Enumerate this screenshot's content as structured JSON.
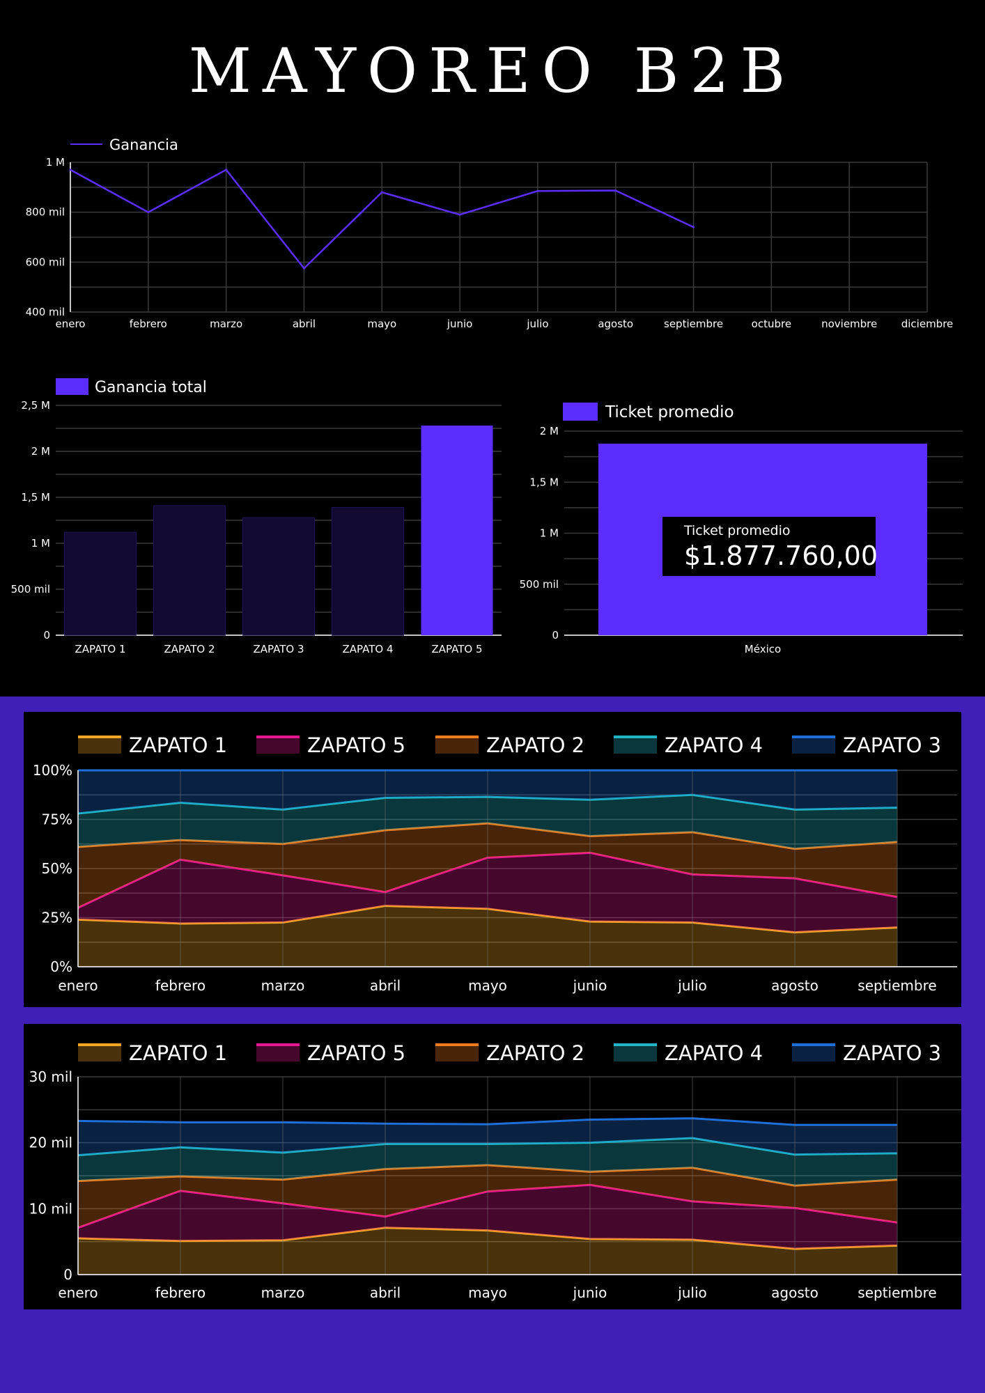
{
  "page": {
    "title": "MAYOREO B2B"
  },
  "colors": {
    "primary": "#5b2eff",
    "zapato1": "#f5a623",
    "zapato5": "#e6168e",
    "zapato2": "#f07c1c",
    "zapato4": "#1fb5c4",
    "zapato3": "#1e6fd9"
  },
  "chart_data": [
    {
      "type": "line",
      "title": "",
      "legend": "top-left",
      "series": [
        {
          "name": "Ganancia",
          "values": [
            970000,
            800000,
            970000,
            575000,
            880000,
            790000,
            885000,
            887000,
            740000,
            null,
            null,
            null
          ]
        }
      ],
      "categories": [
        "enero",
        "febrero",
        "marzo",
        "abril",
        "mayo",
        "junio",
        "julio",
        "agosto",
        "septiembre",
        "octubre",
        "noviembre",
        "diciembre"
      ],
      "ylim": [
        400000,
        1000000
      ],
      "yticks": [
        {
          "value": 400000,
          "label": "400 mil"
        },
        {
          "value": 600000,
          "label": "600 mil"
        },
        {
          "value": 800000,
          "label": "800 mil"
        },
        {
          "value": 1000000,
          "label": "1 M"
        }
      ],
      "grid": true
    },
    {
      "type": "bar",
      "legend": "top-left",
      "series": [
        {
          "name": "Ganancia total",
          "values": [
            1120000,
            1410000,
            1280000,
            1390000,
            2280000
          ]
        }
      ],
      "categories": [
        "ZAPATO 1",
        "ZAPATO 2",
        "ZAPATO 3",
        "ZAPATO 4",
        "ZAPATO 5"
      ],
      "highlight_index": 4,
      "ylim": [
        0,
        2500000
      ],
      "yticks": [
        {
          "value": 0,
          "label": "0"
        },
        {
          "value": 500000,
          "label": "500 mil"
        },
        {
          "value": 1000000,
          "label": "1 M"
        },
        {
          "value": 1500000,
          "label": "1,5 M"
        },
        {
          "value": 2000000,
          "label": "2 M"
        },
        {
          "value": 2500000,
          "label": "2,5 M"
        }
      ],
      "grid": true
    },
    {
      "type": "bar",
      "legend": "top-left",
      "series": [
        {
          "name": "Ticket promedio",
          "values": [
            1877760
          ]
        }
      ],
      "categories": [
        "México"
      ],
      "ylim": [
        0,
        2000000
      ],
      "yticks": [
        {
          "value": 0,
          "label": "0"
        },
        {
          "value": 500000,
          "label": "500 mil"
        },
        {
          "value": 1000000,
          "label": "1 M"
        },
        {
          "value": 1500000,
          "label": "1,5 M"
        },
        {
          "value": 2000000,
          "label": "2 M"
        }
      ],
      "tooltip": {
        "label": "Ticket promedio",
        "value": "$1.877.760,00"
      },
      "grid": true
    },
    {
      "type": "area",
      "stacked": "percent",
      "legend": "top",
      "categories": [
        "enero",
        "febrero",
        "marzo",
        "abril",
        "mayo",
        "junio",
        "julio",
        "agosto",
        "septiembre"
      ],
      "series": [
        {
          "name": "ZAPATO 1",
          "values": [
            24,
            22,
            22.5,
            31,
            29.5,
            23,
            22.5,
            17.5,
            20
          ]
        },
        {
          "name": "ZAPATO 5",
          "values": [
            6,
            32.5,
            24,
            7,
            26,
            35,
            24.5,
            27.5,
            15.5
          ]
        },
        {
          "name": "ZAPATO 2",
          "values": [
            31,
            10,
            16,
            31.5,
            17.5,
            8.5,
            21.5,
            15,
            28
          ]
        },
        {
          "name": "ZAPATO 4",
          "values": [
            17,
            19,
            17.5,
            16.5,
            13.5,
            18.5,
            19,
            20,
            17.5
          ]
        },
        {
          "name": "ZAPATO 3",
          "values": [
            22,
            16.5,
            20,
            14,
            13.5,
            15,
            12.5,
            20,
            19
          ]
        }
      ],
      "ylim": [
        0,
        100
      ],
      "yticks": [
        {
          "value": 0,
          "label": "0%"
        },
        {
          "value": 25,
          "label": "25%"
        },
        {
          "value": 50,
          "label": "50%"
        },
        {
          "value": 75,
          "label": "75%"
        },
        {
          "value": 100,
          "label": "100%"
        }
      ],
      "grid": true
    },
    {
      "type": "area",
      "stacked": "absolute",
      "legend": "top",
      "categories": [
        "enero",
        "febrero",
        "marzo",
        "abril",
        "mayo",
        "junio",
        "julio",
        "agosto",
        "septiembre"
      ],
      "series": [
        {
          "name": "ZAPATO 1",
          "values": [
            5500,
            5100,
            5200,
            7100,
            6700,
            5400,
            5300,
            3900,
            4400
          ]
        },
        {
          "name": "ZAPATO 5",
          "values": [
            1600,
            7600,
            5600,
            1700,
            5900,
            8200,
            5800,
            6200,
            3500
          ]
        },
        {
          "name": "ZAPATO 2",
          "values": [
            7100,
            2200,
            3600,
            7200,
            4000,
            2000,
            5100,
            3400,
            6500
          ]
        },
        {
          "name": "ZAPATO 4",
          "values": [
            3900,
            4400,
            4100,
            3800,
            3200,
            4400,
            4500,
            4700,
            4000
          ]
        },
        {
          "name": "ZAPATO 3",
          "values": [
            5200,
            3800,
            4600,
            3100,
            3000,
            3500,
            3000,
            4500,
            4300
          ]
        }
      ],
      "ylim": [
        0,
        30000
      ],
      "yticks": [
        {
          "value": 0,
          "label": "0"
        },
        {
          "value": 10000,
          "label": "10 mil"
        },
        {
          "value": 20000,
          "label": "20 mil"
        },
        {
          "value": 30000,
          "label": "30 mil"
        }
      ],
      "grid": true
    }
  ]
}
